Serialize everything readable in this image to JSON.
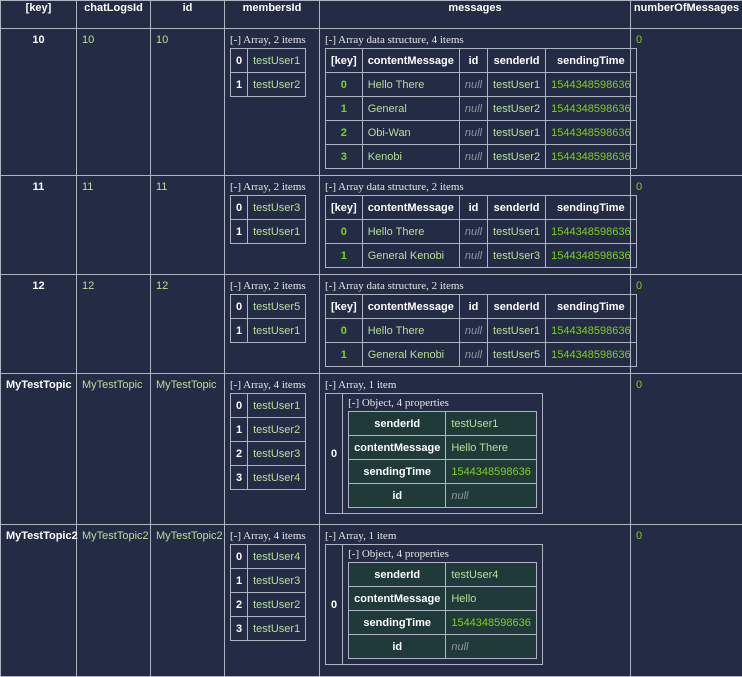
{
  "columns": [
    "[key]",
    "chatLogsId",
    "id",
    "membersId",
    "messages",
    "numberOfMessages"
  ],
  "message_columns": [
    "[key]",
    "contentMessage",
    "id",
    "senderId",
    "sendingTime"
  ],
  "rows": [
    {
      "key": "10",
      "chatLogsId": "10",
      "id": "10",
      "members_label": "[-] Array, 2 items",
      "members": [
        [
          "0",
          "testUser1"
        ],
        [
          "1",
          "testUser2"
        ]
      ],
      "messages_label": "[-] Array data structure, 4 items",
      "messages": [
        [
          "0",
          "Hello There",
          "null",
          "testUser1",
          "1544348598636"
        ],
        [
          "1",
          "General",
          "null",
          "testUser2",
          "1544348598636"
        ],
        [
          "2",
          "Obi-Wan",
          "null",
          "testUser1",
          "1544348598636"
        ],
        [
          "3",
          "Kenobi",
          "null",
          "testUser2",
          "1544348598636"
        ]
      ],
      "numberOfMessages": "0"
    },
    {
      "key": "11",
      "chatLogsId": "11",
      "id": "11",
      "members_label": "[-] Array, 2 items",
      "members": [
        [
          "0",
          "testUser3"
        ],
        [
          "1",
          "testUser1"
        ]
      ],
      "messages_label": "[-] Array data structure, 2 items",
      "messages": [
        [
          "0",
          "Hello There",
          "null",
          "testUser1",
          "1544348598636"
        ],
        [
          "1",
          "General Kenobi",
          "null",
          "testUser3",
          "1544348598636"
        ]
      ],
      "numberOfMessages": "0"
    },
    {
      "key": "12",
      "chatLogsId": "12",
      "id": "12",
      "members_label": "[-] Array, 2 items",
      "members": [
        [
          "0",
          "testUser5"
        ],
        [
          "1",
          "testUser1"
        ]
      ],
      "messages_label": "[-] Array data structure, 2 items",
      "messages": [
        [
          "0",
          "Hello There",
          "null",
          "testUser1",
          "1544348598636"
        ],
        [
          "1",
          "General Kenobi",
          "null",
          "testUser5",
          "1544348598636"
        ]
      ],
      "numberOfMessages": "0"
    },
    {
      "key": "MyTestTopic",
      "chatLogsId": "MyTestTopic",
      "id": "MyTestTopic",
      "members_label": "[-] Array, 4 items",
      "members": [
        [
          "0",
          "testUser1"
        ],
        [
          "1",
          "testUser2"
        ],
        [
          "2",
          "testUser3"
        ],
        [
          "3",
          "testUser4"
        ]
      ],
      "messages_label": "[-] Array, 1 item",
      "object": {
        "index": "0",
        "label": "[-] Object, 4 properties",
        "props": [
          [
            "senderId",
            "testUser1"
          ],
          [
            "contentMessage",
            "Hello There"
          ],
          [
            "sendingTime",
            "1544348598636"
          ],
          [
            "id",
            "null"
          ]
        ]
      },
      "numberOfMessages": "0"
    },
    {
      "key": "MyTestTopic2",
      "chatLogsId": "MyTestTopic2",
      "id": "MyTestTopic2",
      "members_label": "[-] Array, 4 items",
      "members": [
        [
          "0",
          "testUser4"
        ],
        [
          "1",
          "testUser3"
        ],
        [
          "2",
          "testUser2"
        ],
        [
          "3",
          "testUser1"
        ]
      ],
      "messages_label": "[-] Array, 1 item",
      "object": {
        "index": "0",
        "label": "[-] Object, 4 properties",
        "props": [
          [
            "senderId",
            "testUser4"
          ],
          [
            "contentMessage",
            "Hello"
          ],
          [
            "sendingTime",
            "1544348598636"
          ],
          [
            "id",
            "null"
          ]
        ]
      },
      "numberOfMessages": "0"
    }
  ],
  "colors": {
    "background": "#242b44",
    "string": "#b8df97",
    "number": "#7fd11a",
    "object_bg": "#1f3a39",
    "border": "#aeb4c2"
  }
}
